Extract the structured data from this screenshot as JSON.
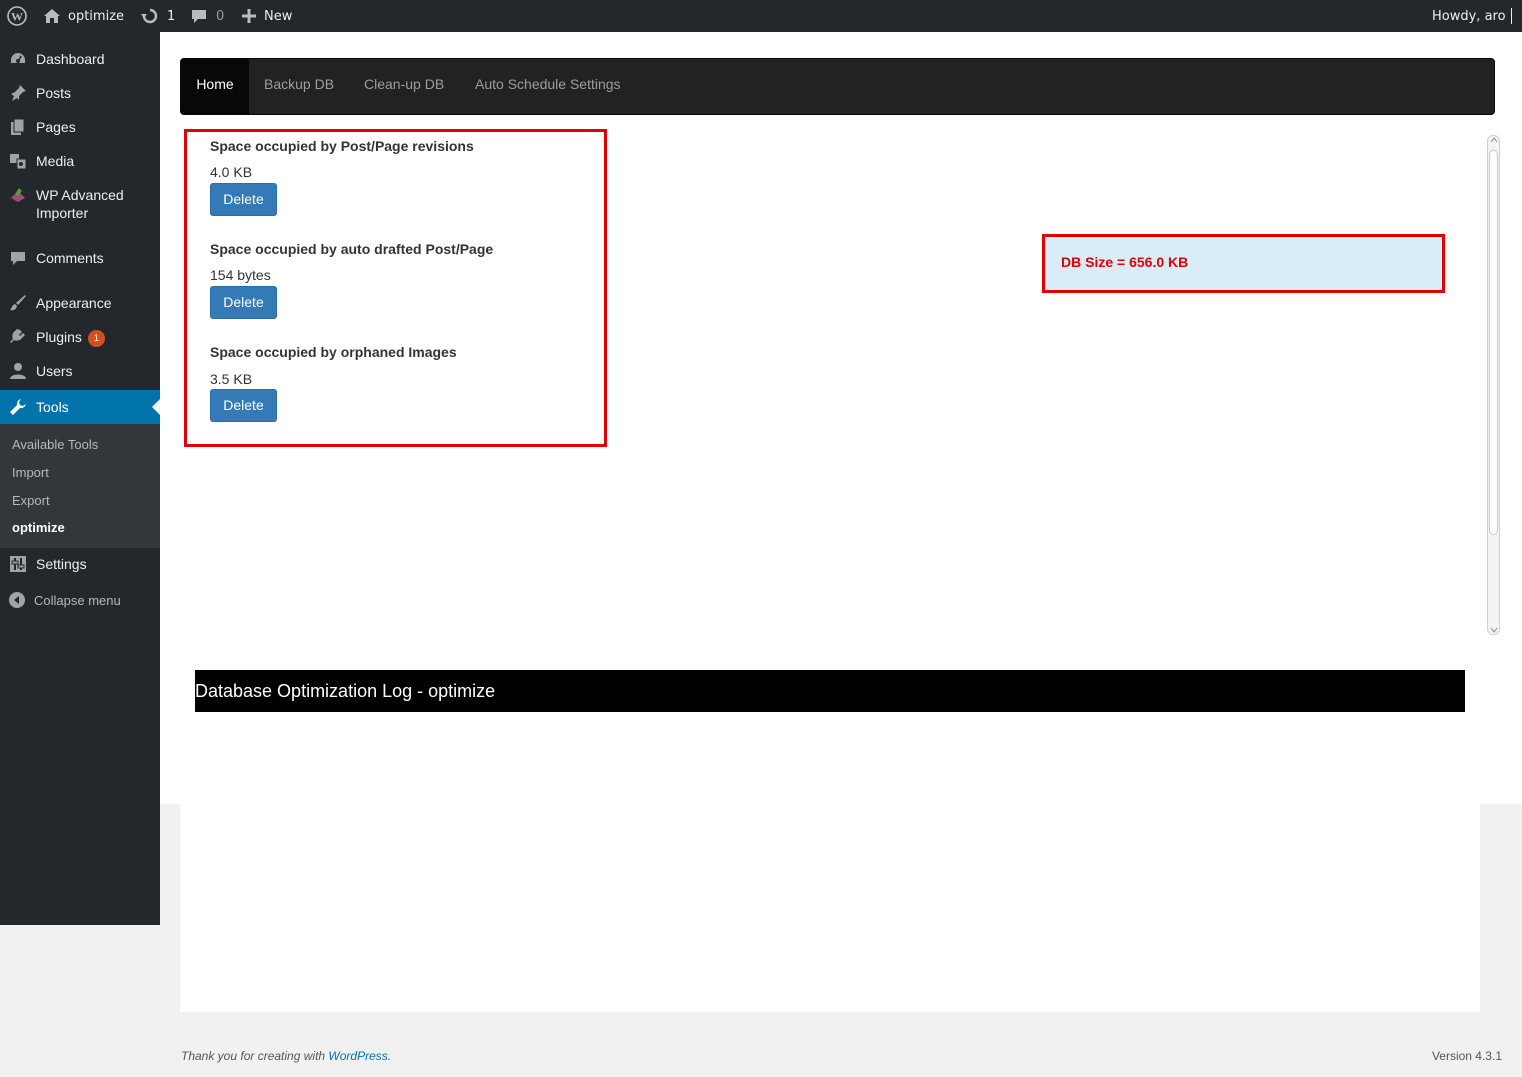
{
  "adminbar": {
    "site_name": "optimize",
    "updates_count": "1",
    "comments_count": "0",
    "new_label": "New",
    "howdy": "Howdy, aro"
  },
  "sidebar": {
    "items": [
      {
        "label": "Dashboard",
        "icon": "dashboard-icon"
      },
      {
        "label": "Posts",
        "icon": "pin-icon"
      },
      {
        "label": "Pages",
        "icon": "pages-icon"
      },
      {
        "label": "Media",
        "icon": "media-icon"
      },
      {
        "label": "WP Advanced",
        "label2": "Importer",
        "icon": "importer-icon"
      },
      {
        "label": "Comments",
        "icon": "comment-icon"
      },
      {
        "label": "Appearance",
        "icon": "brush-icon"
      },
      {
        "label": "Plugins",
        "icon": "plugin-icon",
        "badge": "1"
      },
      {
        "label": "Users",
        "icon": "user-icon"
      },
      {
        "label": "Tools",
        "icon": "wrench-icon"
      },
      {
        "label": "Settings",
        "icon": "settings-icon"
      },
      {
        "label": "Collapse menu",
        "icon": "collapse-icon"
      }
    ],
    "submenu": [
      "Available Tools",
      "Import",
      "Export",
      "optimize"
    ]
  },
  "nav": {
    "tabs": [
      "Home",
      "Backup DB",
      "Clean-up DB",
      "Auto Schedule Settings"
    ]
  },
  "sections": [
    {
      "title": "Space occupied by Post/Page revisions",
      "value": "4.0 KB",
      "button": "Delete"
    },
    {
      "title": "Space occupied by auto drafted Post/Page",
      "value": "154 bytes",
      "button": "Delete"
    },
    {
      "title": "Space occupied by orphaned Images",
      "value": "3.5 KB",
      "button": "Delete"
    }
  ],
  "db_size": "DB Size = 656.0 KB",
  "log_title": "Database Optimization Log - optimize",
  "footer": {
    "thanks": "Thank you for creating with ",
    "wp_link": "WordPress",
    "period": ".",
    "version": "Version 4.3.1"
  },
  "colors": {
    "adminbar_bg": "#23282d",
    "current_menu": "#0073aa",
    "button_blue": "#337ab7",
    "highlight_red": "#e00000",
    "info_bg": "#d9edf7"
  }
}
